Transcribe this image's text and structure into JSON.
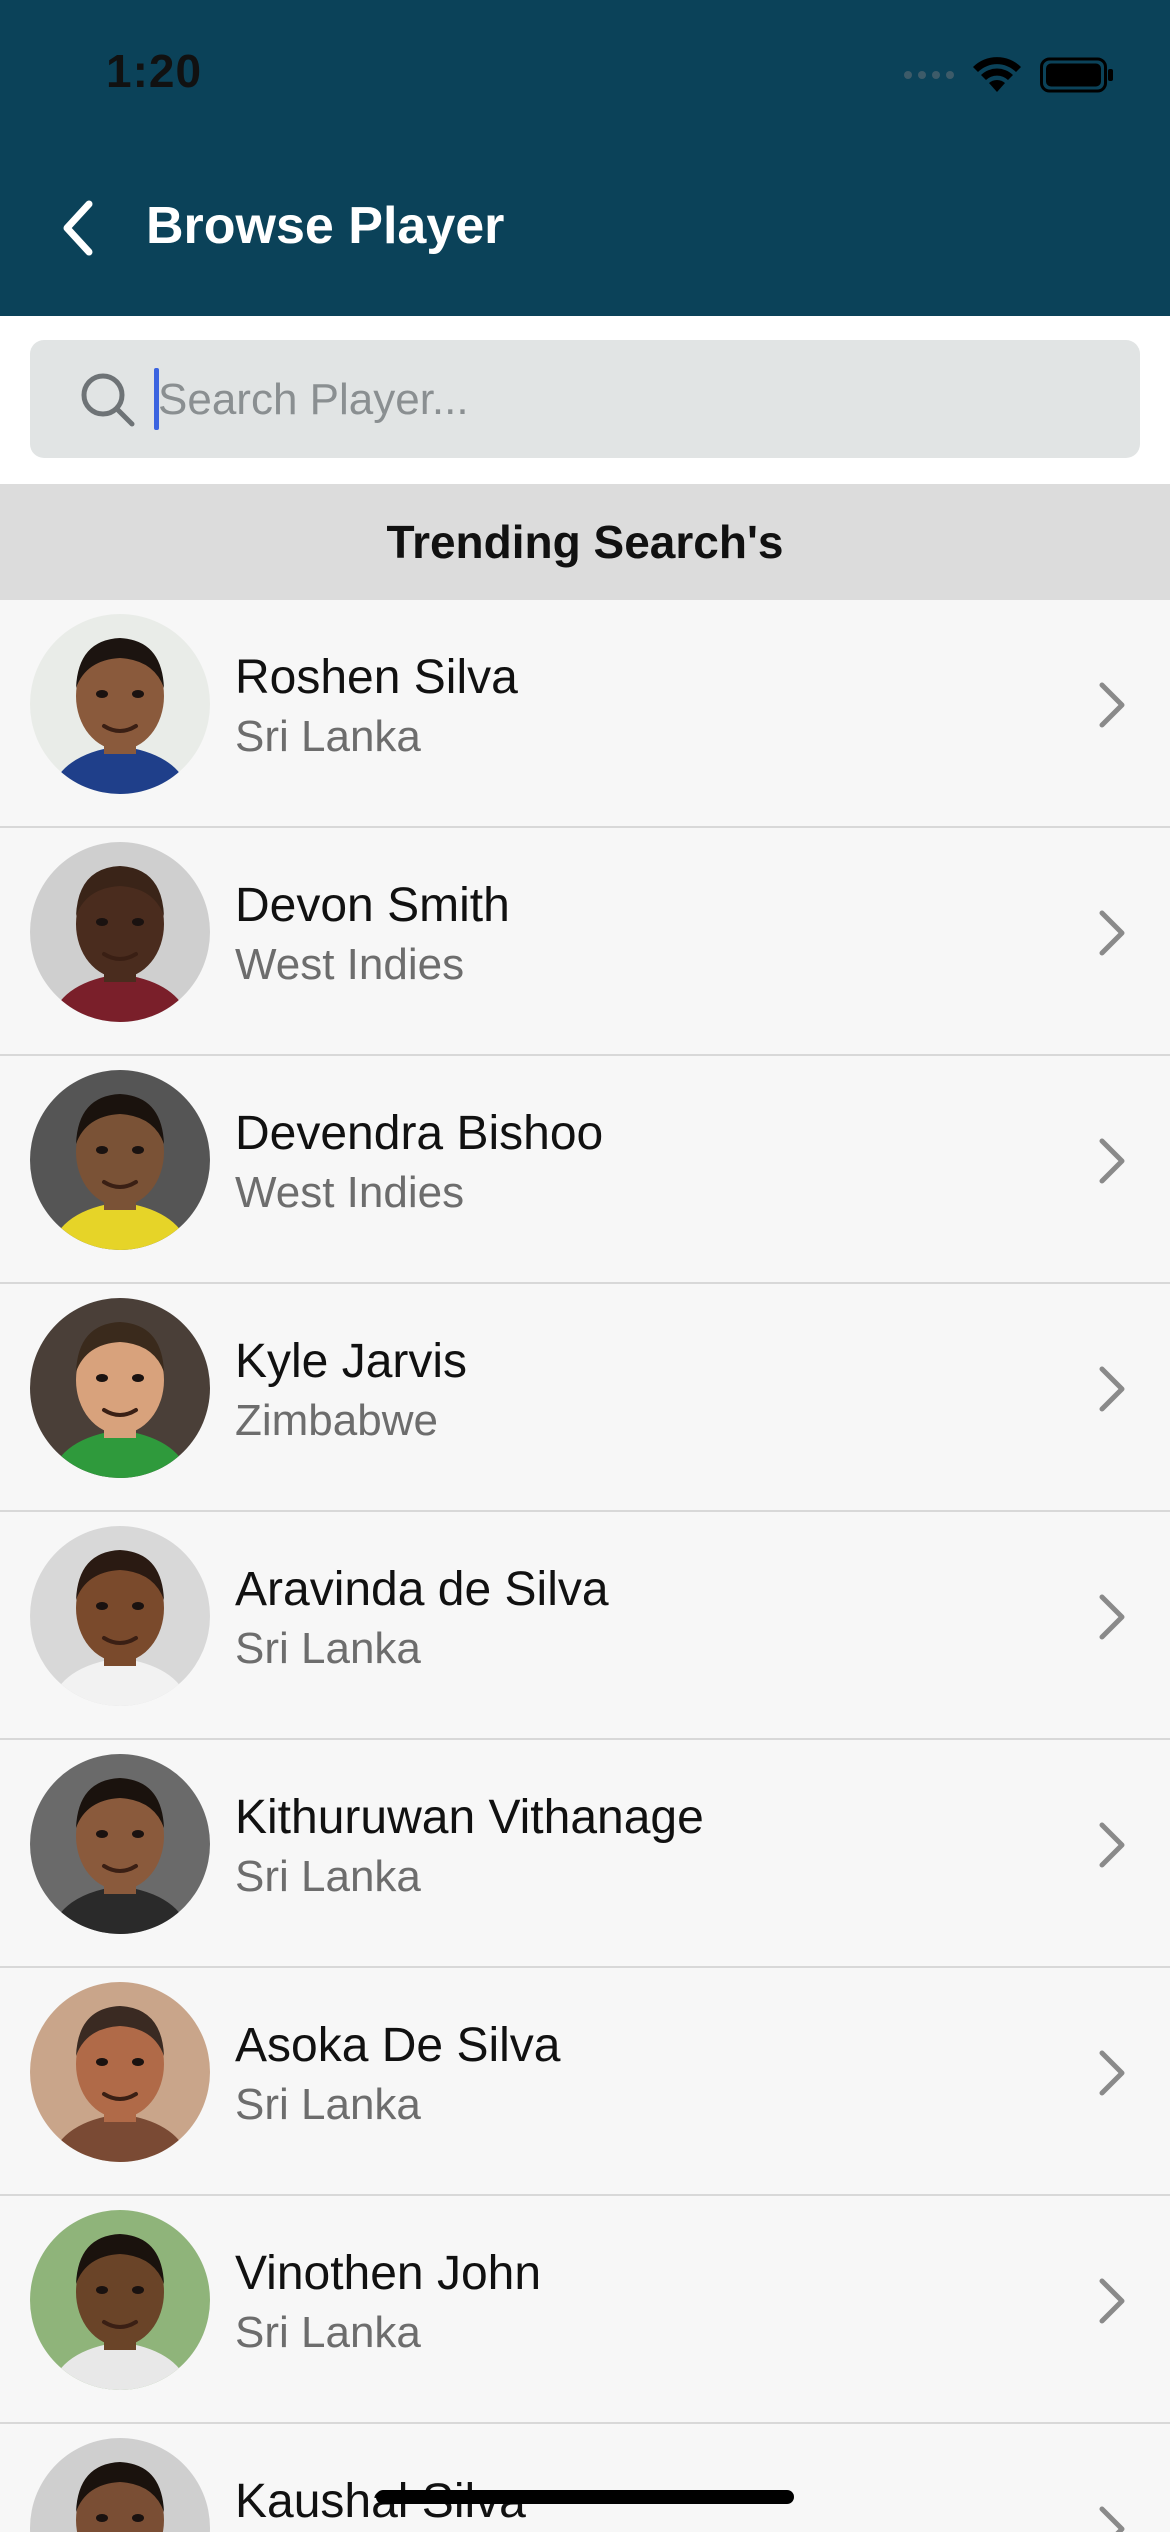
{
  "status_bar": {
    "time": "1:20"
  },
  "header": {
    "title": "Browse Player"
  },
  "search": {
    "placeholder": "Search Player...",
    "value": ""
  },
  "section": {
    "title": "Trending Search's"
  },
  "players": [
    {
      "name": "Roshen Silva",
      "country": "Sri Lanka",
      "skin": "#8a5a3c",
      "hair": "#1c1410",
      "bg": "#e9ece8",
      "shirt": "#1f3f8a"
    },
    {
      "name": "Devon Smith",
      "country": "West Indies",
      "skin": "#4a2c1e",
      "hair": "#3a2418",
      "bg": "#cfcfcf",
      "shirt": "#7a1f2a"
    },
    {
      "name": "Devendra Bishoo",
      "country": "West Indies",
      "skin": "#7a5236",
      "hair": "#1a120d",
      "bg": "#555555",
      "shirt": "#e6d428"
    },
    {
      "name": "Kyle Jarvis",
      "country": "Zimbabwe",
      "skin": "#d8a27c",
      "hair": "#3a2a1c",
      "bg": "#4a3f38",
      "shirt": "#2f9a3c"
    },
    {
      "name": "Aravinda de Silva",
      "country": "Sri Lanka",
      "skin": "#7a4a2c",
      "hair": "#2a1a12",
      "bg": "#d8d8d8",
      "shirt": "#f2f2f2"
    },
    {
      "name": "Kithuruwan Vithanage",
      "country": "Sri Lanka",
      "skin": "#8a5a3c",
      "hair": "#1a120d",
      "bg": "#6a6a6a",
      "shirt": "#2a2a2a"
    },
    {
      "name": "Asoka De Silva",
      "country": "Sri Lanka",
      "skin": "#b06a48",
      "hair": "#3a2a22",
      "bg": "#c9a58a",
      "shirt": "#7a4a34"
    },
    {
      "name": "Vinothen John",
      "country": "Sri Lanka",
      "skin": "#6a4428",
      "hair": "#1a120d",
      "bg": "#8fb47a",
      "shirt": "#e8e8e8"
    },
    {
      "name": "Kaushal Silva",
      "country": "",
      "skin": "#7a4e34",
      "hair": "#1a120d",
      "bg": "#cfcfcf",
      "shirt": "#1f3f8a"
    }
  ]
}
